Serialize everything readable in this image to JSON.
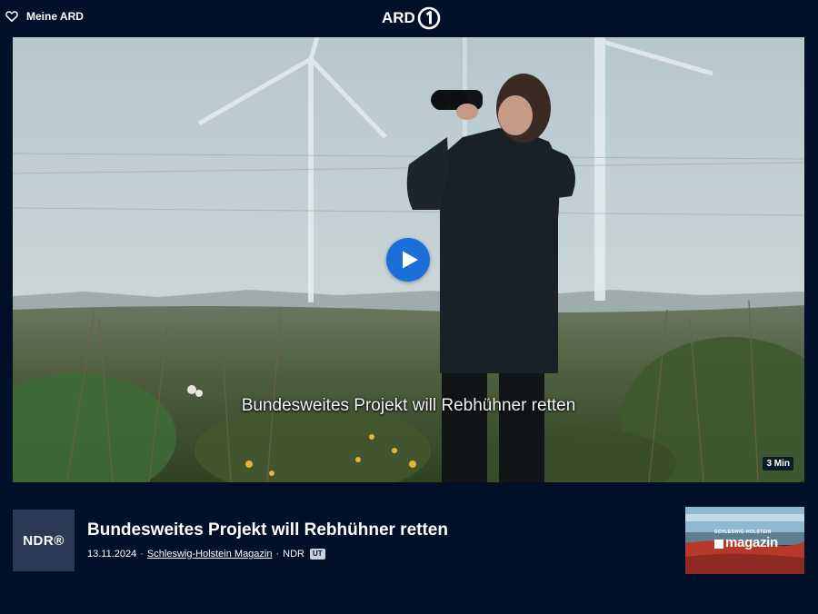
{
  "header": {
    "favorites_label": "Meine ARD",
    "logo_text": "ARD",
    "icons": {
      "favorites": "heart-icon",
      "logo_mark": "ard-one-logo"
    }
  },
  "player": {
    "subtitle_text": "Bundesweites Projekt will Rebhühner retten",
    "duration": "3 Min",
    "play_icon": "play-icon"
  },
  "video_info": {
    "channel_logo_text": "NDR®",
    "title": "Bundesweites Projekt will Rebhühner retten",
    "date": "13.11.2024",
    "separator": "·",
    "show_link": "Schleswig-Holstein Magazin",
    "broadcaster": "NDR",
    "subtitle_badge": "UT"
  },
  "show_thumbnail": {
    "super_text": "SCHLESWIG-HOLSTEIN",
    "label": "magazin"
  },
  "colors": {
    "background": "#001028",
    "play_button": "#1a6fd9",
    "sender_tile": "#2b3a55"
  }
}
